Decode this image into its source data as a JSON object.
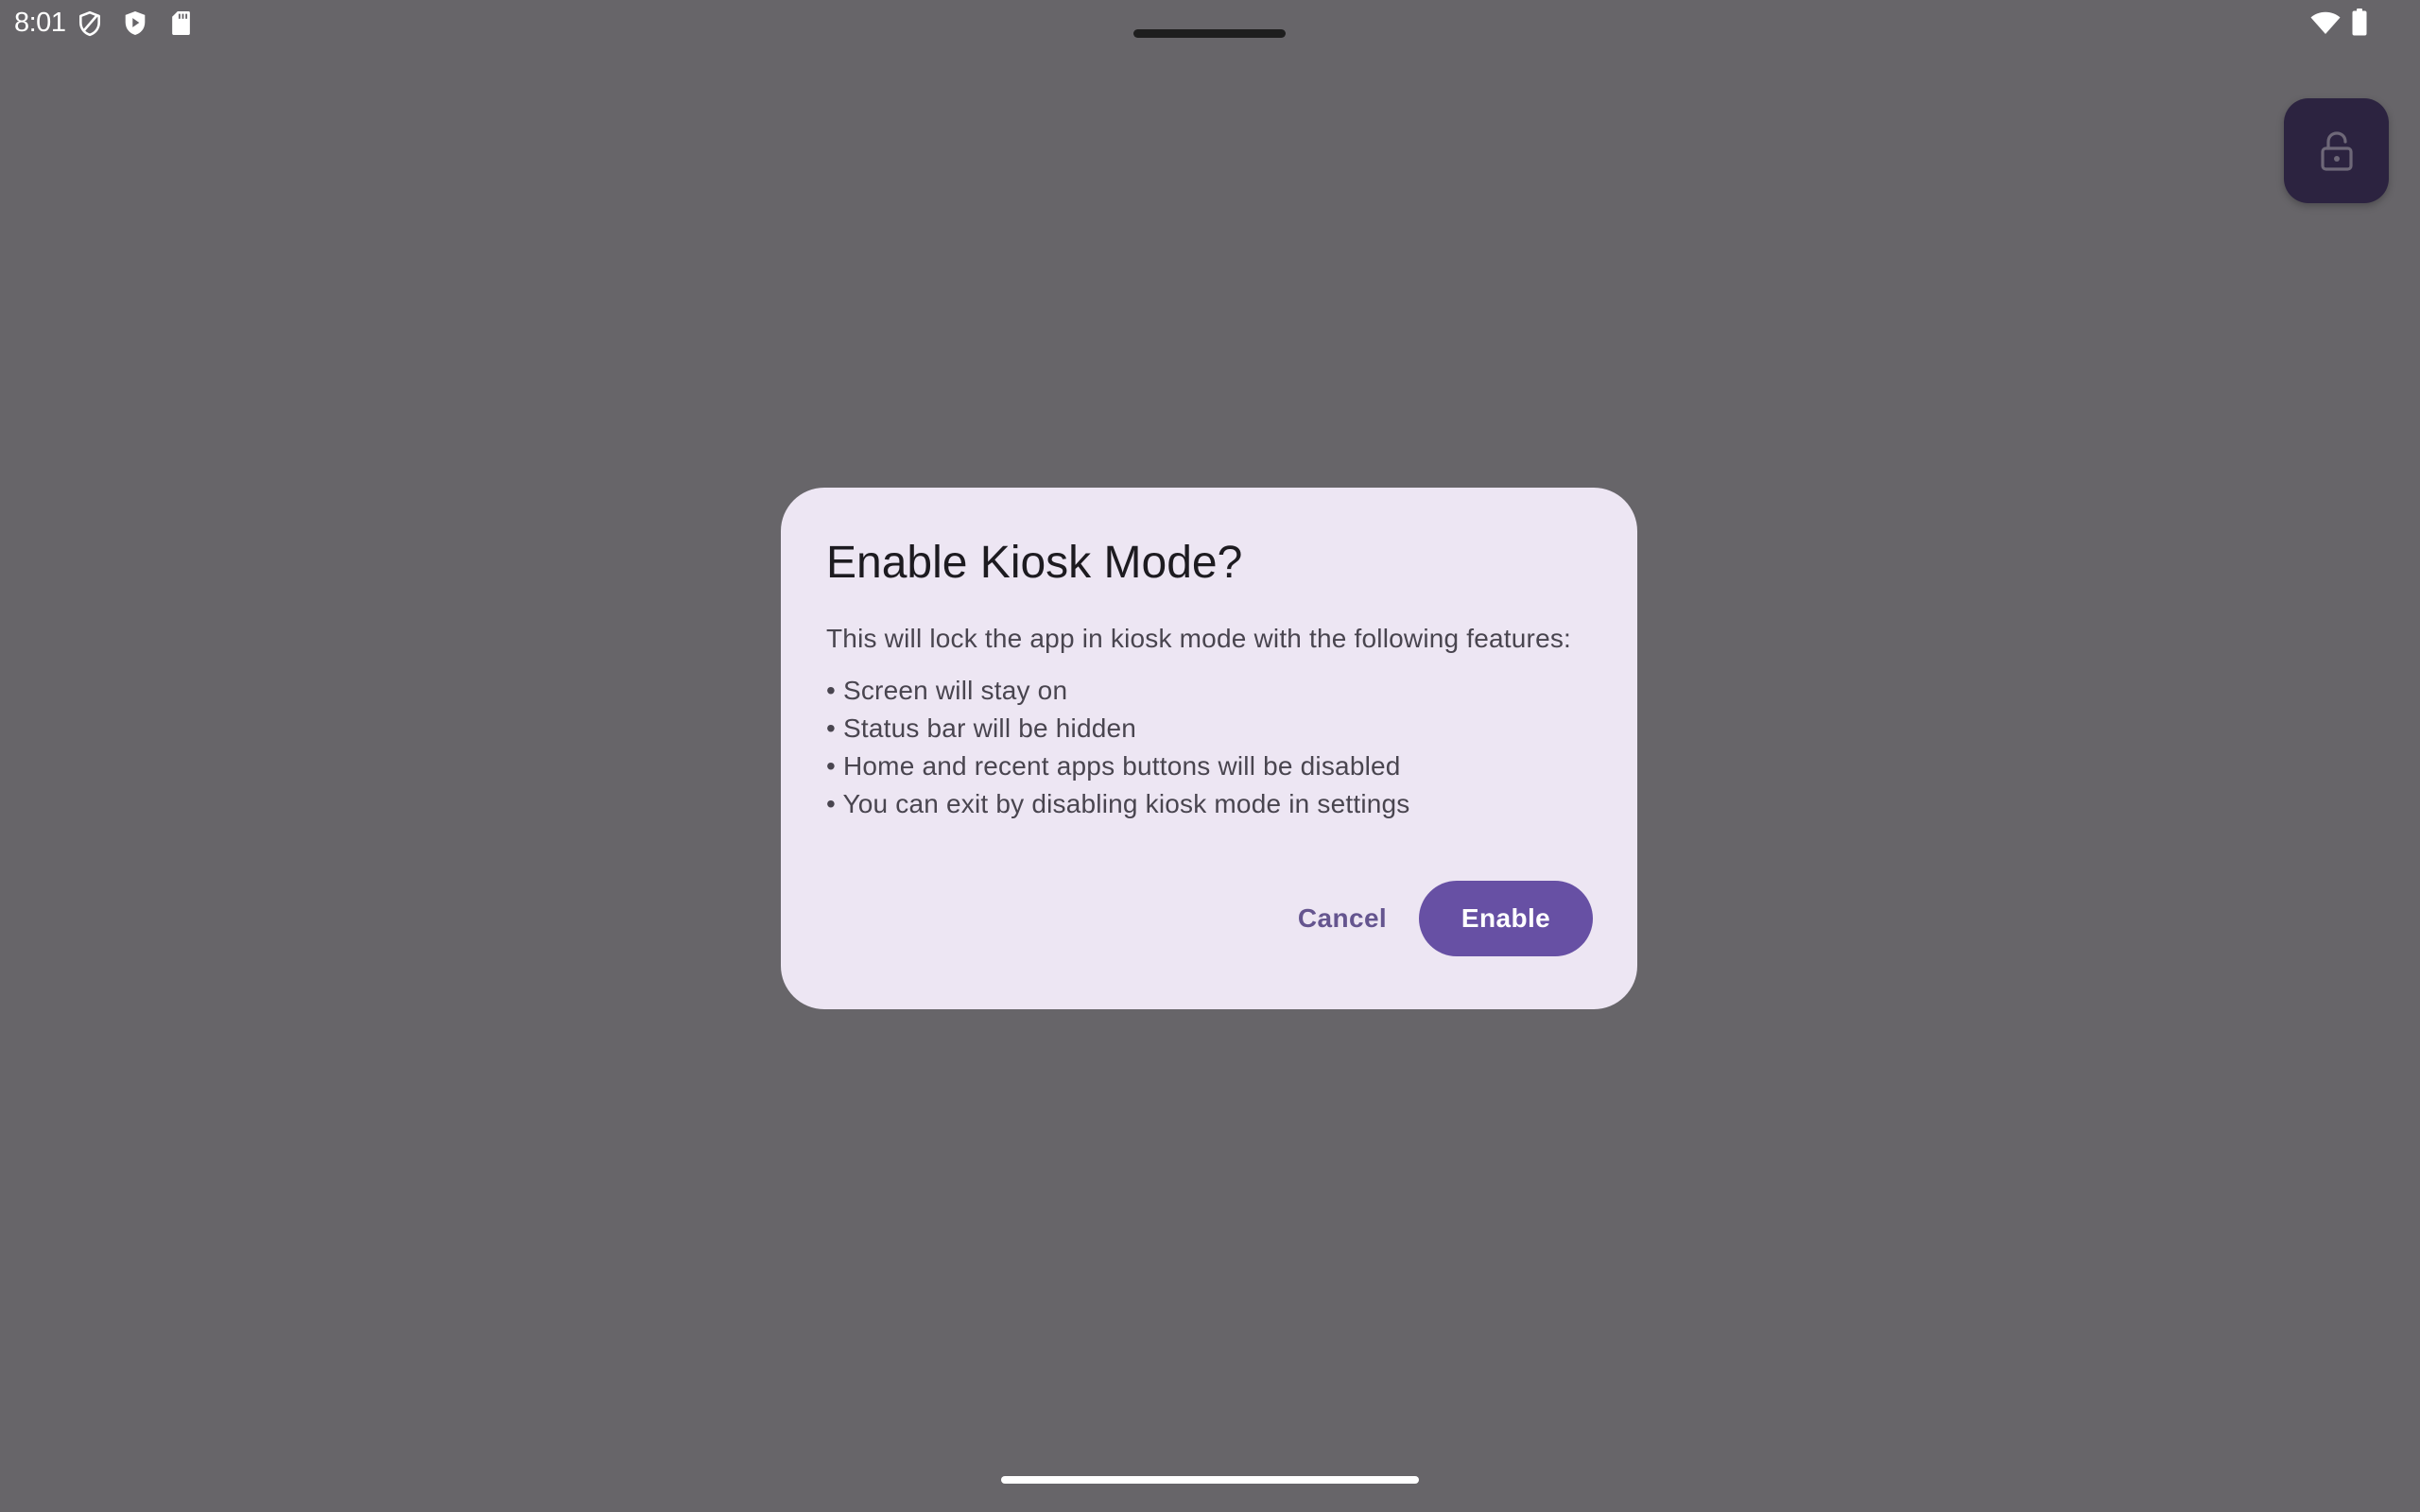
{
  "status_bar": {
    "time": "8:01",
    "left_icons": [
      "vpn-shield-icon",
      "play-protect-icon",
      "sd-card-icon"
    ],
    "right_icons": [
      "wifi-icon",
      "battery-icon"
    ]
  },
  "fab": {
    "icon": "lock-open-icon"
  },
  "dialog": {
    "title": "Enable Kiosk Mode?",
    "intro": "This will lock the app in kiosk mode with the following features:",
    "bullets": [
      "• Screen will stay on",
      "• Status bar will be hidden",
      "• Home and recent apps buttons will be disabled",
      "• You can exit by disabling kiosk mode in settings"
    ],
    "cancel_label": "Cancel",
    "enable_label": "Enable"
  },
  "colors": {
    "scrim_background": "#676569",
    "dialog_surface": "#ede6f3",
    "primary": "#6750a4",
    "text_button": "#65558f",
    "fab_container": "#2c2340"
  }
}
